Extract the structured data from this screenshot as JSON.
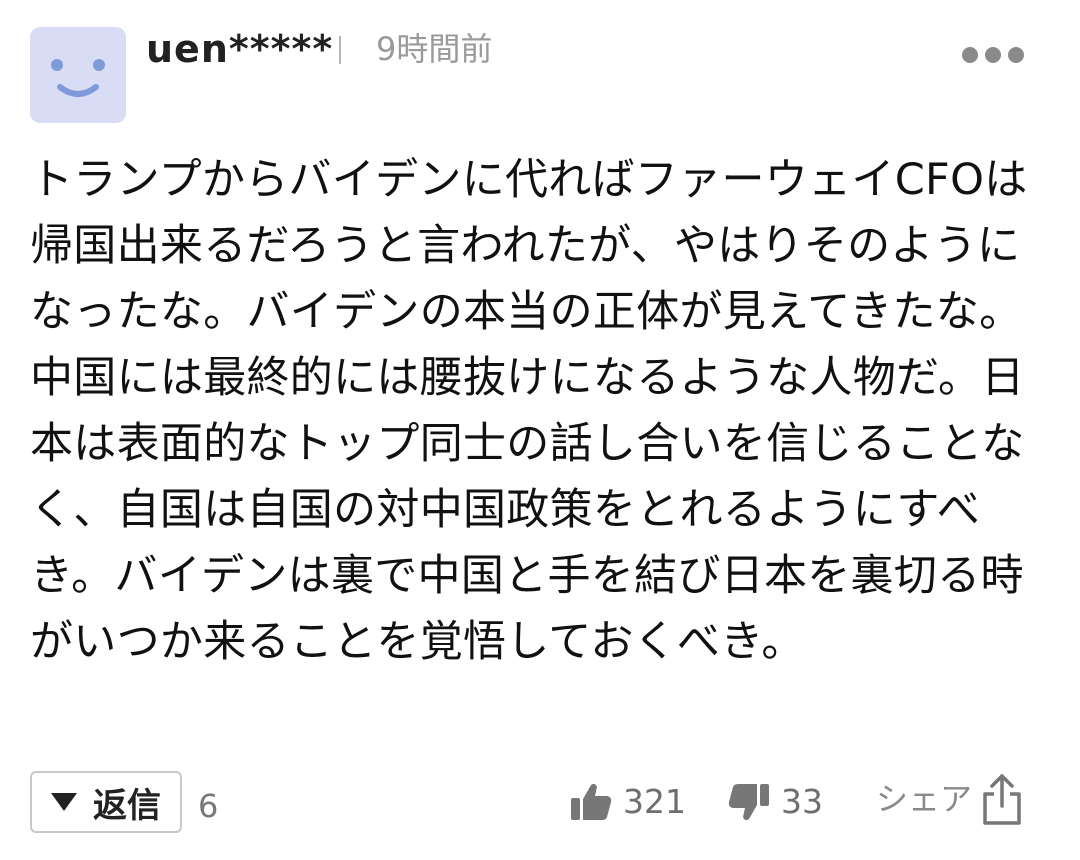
{
  "comment": {
    "username": "uen*****",
    "time": "9時間前",
    "avatar_icon": "smiley-face-icon",
    "body": "トランプからバイデンに代ればファーウェイCFOは帰国出来るだろうと言われたが、やはりそのようになったな。バイデンの本当の正体が見えてきたな。中国には最終的には腰抜けになるような人物だ。日本は表面的なトップ同士の話し合いを信じることなく、自国は自国の対中国政策をとれるようにすべき。バイデンは裏で中国と手を結び日本を裏切る時がいつか来ることを覚悟しておくべき。"
  },
  "actions": {
    "reply_label": "返信",
    "reply_count": "6",
    "like_count": "321",
    "dislike_count": "33",
    "share_label": "シェア"
  },
  "icons": {
    "more": "more-dots-icon",
    "reply_toggle": "triangle-down-icon",
    "like": "thumbs-up-icon",
    "dislike": "thumbs-down-icon",
    "share": "share-icon"
  },
  "colors": {
    "avatar_bg": "#d9dcf5",
    "avatar_face": "#7f9ad8",
    "muted_text": "#9a9a9a",
    "icon_gray": "#777777"
  }
}
